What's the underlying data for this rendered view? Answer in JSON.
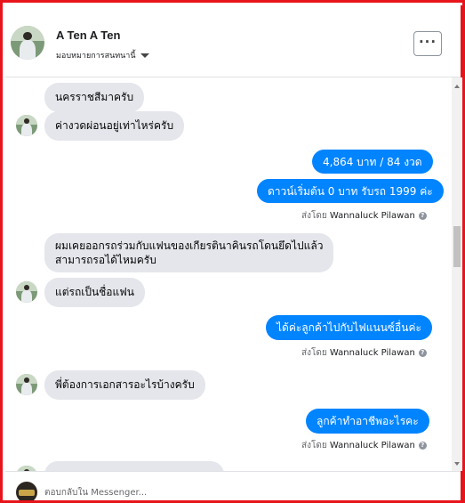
{
  "header": {
    "name": "A Ten A Ten",
    "subtitle": "มอบหมายการสนทนานี้",
    "more_label": "···"
  },
  "messages": [
    {
      "dir": "in",
      "text": "นครราชสีมาครับ"
    },
    {
      "dir": "in",
      "text": "ค่างวดผ่อนอยู่เท่าไหร่ครับ"
    },
    {
      "dir": "out",
      "text": "4,864 บาท   / 84 งวด"
    },
    {
      "dir": "out",
      "text": "ดาวน์เริ่มต้น 0 บาท รับรถ 1999 ค่ะ"
    },
    {
      "dir": "sent",
      "prefix": "ส่งโดย",
      "author": "Wannaluck Pilawan"
    },
    {
      "dir": "in",
      "text": "ผมเคยออกรถร่วมกับแฟนของเกียรตินาคินรถโดนยึดไปแล้ว\nสามารถรอได้ไหมครับ"
    },
    {
      "dir": "in",
      "text": "แต่รถเป็นชื่อแฟน"
    },
    {
      "dir": "out",
      "text": "ได้ค่ะลูกค้าไปกับไฟแนนซ์อื่นค่ะ"
    },
    {
      "dir": "sent",
      "prefix": "ส่งโดย",
      "author": "Wannaluck Pilawan"
    },
    {
      "dir": "in",
      "text": "พี่ต้องการเอกสารอะไรบ้างครับ"
    },
    {
      "dir": "out",
      "text": "ลูกค้าทำอาชีพอะไรคะ"
    },
    {
      "dir": "sent",
      "prefix": "ส่งโดย",
      "author": "Wannaluck Pilawan"
    }
  ],
  "composer": {
    "placeholder": "ตอบกลับใน Messenger..."
  },
  "colors": {
    "frame": "#e8141b",
    "outgoing_bubble": "#0084ff",
    "incoming_bubble": "#e4e6eb"
  }
}
